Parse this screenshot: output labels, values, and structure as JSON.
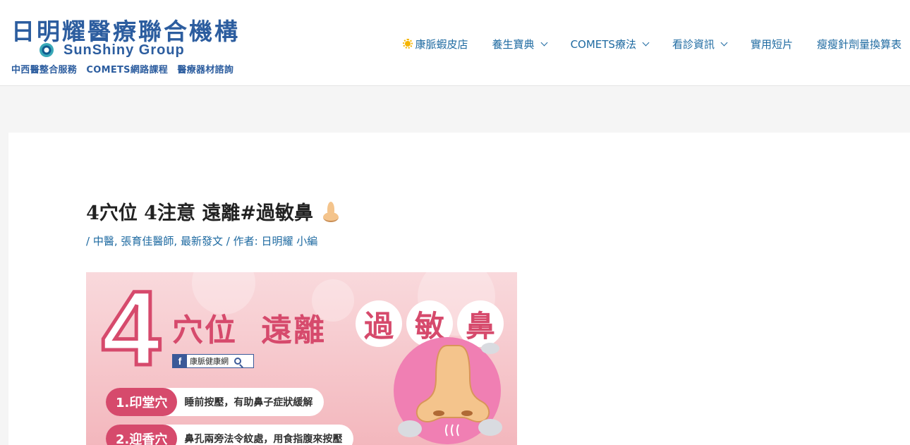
{
  "header": {
    "logo": {
      "title": "日明耀醫療聯合機構",
      "brand": "SunShiny Group",
      "tagline": "中西醫整合服務　COMETS網路課程　醫療器材諮詢"
    },
    "nav": [
      {
        "label": "康脈蝦皮店",
        "icon": "sun-icon",
        "has_dropdown": false
      },
      {
        "label": "養生寶典",
        "has_dropdown": true
      },
      {
        "label": "COMETS療法",
        "has_dropdown": true
      },
      {
        "label": "看診資訊",
        "has_dropdown": true
      },
      {
        "label": "實用短片",
        "has_dropdown": false
      },
      {
        "label": "瘦瘦針劑量換算表",
        "has_dropdown": false
      }
    ]
  },
  "post": {
    "title": "4穴位 4注意 遠離#過敏鼻",
    "title_icon": "nose-emoji-icon",
    "meta": {
      "prefix": "/",
      "categories": [
        "中醫",
        "張育佳醫師",
        "最新發文"
      ],
      "author_prefix": "/ 作者:",
      "author": "日明耀 小編"
    },
    "featured_image": {
      "number": "4",
      "headline_plain_1": "穴位",
      "headline_plain_2": "遠離",
      "headline_circled": [
        "過",
        "敏",
        "鼻"
      ],
      "badge_label": "康脈健康網",
      "badge_icon": "f",
      "points": [
        {
          "name": "1.印堂穴",
          "desc": "睡前按壓，有助鼻子症狀緩解"
        },
        {
          "name": "2.迎香穴",
          "desc": "鼻孔兩旁法令紋處，用食指腹來按壓"
        }
      ]
    }
  },
  "colors": {
    "brand_blue": "#2c5d9f",
    "link_blue": "#1e6aa1",
    "accent_pink": "#d64a6c",
    "nose_circle": "#f07fb3"
  }
}
